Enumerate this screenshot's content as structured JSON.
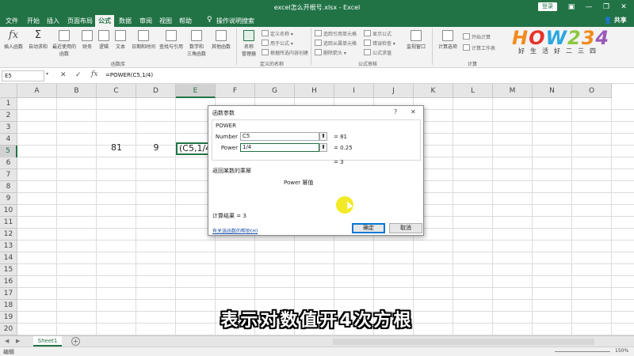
{
  "titlebar": {
    "title": "excel怎么开根号.xlsx  -  Excel",
    "login": "登录",
    "win_buttons": [
      "▣",
      "—",
      "❐",
      "✕"
    ]
  },
  "menu": {
    "items": [
      {
        "label": "文件"
      },
      {
        "label": "开始"
      },
      {
        "label": "插入"
      },
      {
        "label": "页面布局"
      },
      {
        "label": "公式",
        "active": true
      },
      {
        "label": "数据"
      },
      {
        "label": "审阅"
      },
      {
        "label": "视图"
      },
      {
        "label": "帮助"
      },
      {
        "label": "操作说明搜索"
      }
    ],
    "share": "共享"
  },
  "ribbon": {
    "buttons": [
      {
        "label": "插入函数"
      },
      {
        "label": "自动求和"
      },
      {
        "label": "最近使用的\n函数"
      },
      {
        "label": "财务"
      },
      {
        "label": "逻辑"
      },
      {
        "label": "文本"
      },
      {
        "label": "日期和时间"
      },
      {
        "label": "查找与引用"
      },
      {
        "label": "数学和\n三角函数"
      },
      {
        "label": "其他函数"
      },
      {
        "label": "名称\n管理器"
      }
    ],
    "define_names": [
      "定义名称 ▾",
      "用于公式 ▾",
      "根据所选内容创建"
    ],
    "audit": [
      "追踪引用单元格",
      "追踪从属单元格",
      "删除箭头 ▾",
      "显示公式",
      "错误检查 ▾",
      "公式求值"
    ],
    "watch": "监视窗口",
    "calc_options": "计算选项",
    "calc": [
      "开始计算",
      "计算工作表"
    ],
    "groups": {
      "library": "函数库",
      "names": "定义的名称",
      "audit": "公式审核",
      "calc": "计算"
    }
  },
  "logo": {
    "word": "HOW234",
    "tagline": "好生活好二三四"
  },
  "formula_bar": {
    "name_box": "E5",
    "cancel": "✕",
    "enter": "✓",
    "fx": "fx",
    "formula": "=POWER(C5,1/4)"
  },
  "grid": {
    "columns": [
      "A",
      "B",
      "C",
      "D",
      "E",
      "F",
      "G",
      "H",
      "I",
      "J",
      "K",
      "L",
      "M",
      "N",
      "O"
    ],
    "rows": [
      "1",
      "2",
      "3",
      "4",
      "5",
      "6",
      "7",
      "8",
      "9",
      "10",
      "11",
      "12",
      "13",
      "14",
      "15",
      "16",
      "17",
      "18",
      "19",
      "20"
    ],
    "selected_col": "E",
    "selected_row": "5",
    "c5": "81",
    "d5": "9",
    "e5": "(C5,1/4)"
  },
  "dialog": {
    "title": "函数参数",
    "help": "?",
    "close": "✕",
    "function_name": "POWER",
    "args": [
      {
        "label": "Number",
        "value": "C5",
        "result": "=  81"
      },
      {
        "label": "Power",
        "value": "1/4",
        "result": "=  0.25"
      }
    ],
    "total": "=  3",
    "desc_heading": "返回某数的乘幂",
    "desc_detail": "Power  幂值",
    "result_label": "计算结果 =   3",
    "help_link": "有关该函数的帮助(H)",
    "ok": "确定",
    "cancel": "取消"
  },
  "subtitle": "表示对数值开4次方根",
  "sheets": {
    "tab": "Sheet1",
    "nav": [
      "◀",
      "▶"
    ],
    "add": "+"
  },
  "status": {
    "mode": "编辑",
    "zoom": "150%"
  },
  "colors": {
    "excel_green": "#217346",
    "cursor_highlight": "#f0e600",
    "link": "#1a4fa3"
  }
}
